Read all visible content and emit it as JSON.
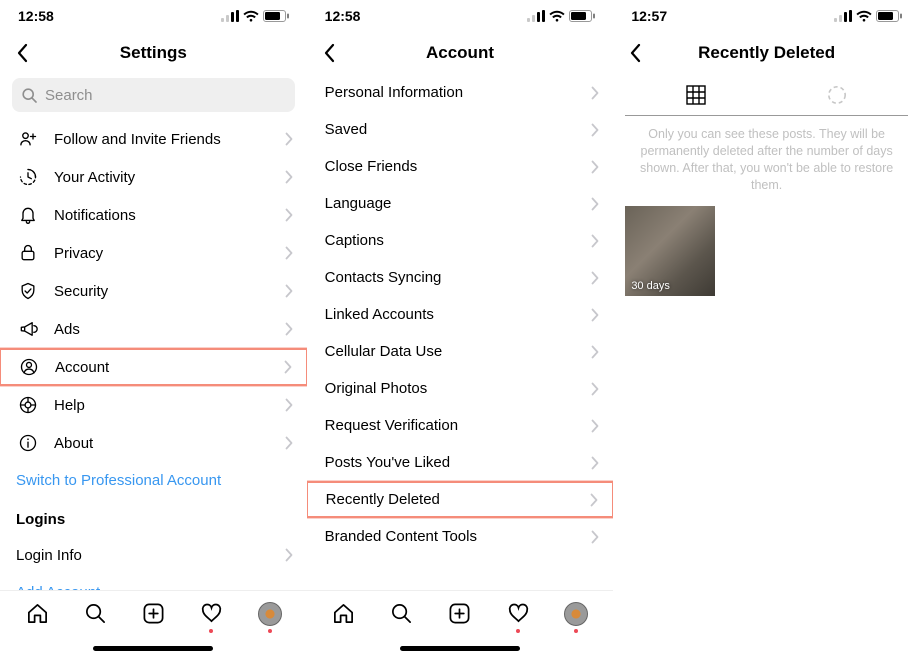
{
  "screens": [
    {
      "time": "12:58",
      "title": "Settings",
      "searchPlaceholder": "Search",
      "items": [
        {
          "icon": "invite",
          "label": "Follow and Invite Friends"
        },
        {
          "icon": "activity",
          "label": "Your Activity"
        },
        {
          "icon": "bell",
          "label": "Notifications"
        },
        {
          "icon": "lock",
          "label": "Privacy"
        },
        {
          "icon": "shield",
          "label": "Security"
        },
        {
          "icon": "megaphone",
          "label": "Ads"
        },
        {
          "icon": "account",
          "label": "Account",
          "highlight": true
        },
        {
          "icon": "help",
          "label": "Help"
        },
        {
          "icon": "info",
          "label": "About"
        }
      ],
      "switchPro": "Switch to Professional Account",
      "loginsHeader": "Logins",
      "loginInfo": "Login Info",
      "addAccount": "Add Account"
    },
    {
      "time": "12:58",
      "title": "Account",
      "items": [
        {
          "label": "Personal Information"
        },
        {
          "label": "Saved"
        },
        {
          "label": "Close Friends"
        },
        {
          "label": "Language"
        },
        {
          "label": "Captions"
        },
        {
          "label": "Contacts Syncing"
        },
        {
          "label": "Linked Accounts"
        },
        {
          "label": "Cellular Data Use"
        },
        {
          "label": "Original Photos"
        },
        {
          "label": "Request Verification"
        },
        {
          "label": "Posts You've Liked"
        },
        {
          "label": "Recently Deleted",
          "highlight": true
        },
        {
          "label": "Branded Content Tools"
        }
      ]
    },
    {
      "time": "12:57",
      "title": "Recently Deleted",
      "infoText": "Only you can see these posts. They will be permanently deleted after the number of days shown. After that, you won't be able to restore them.",
      "thumbLabel": "30 days"
    }
  ]
}
